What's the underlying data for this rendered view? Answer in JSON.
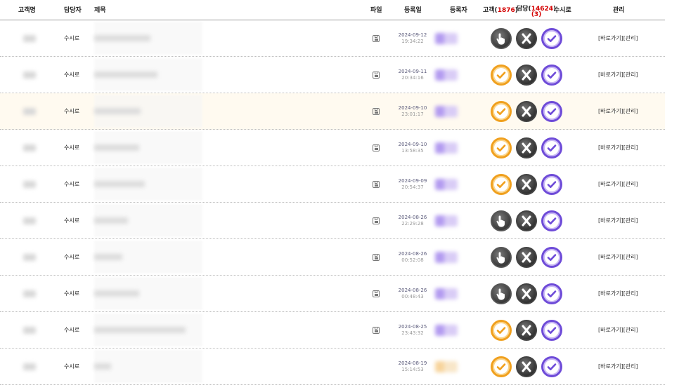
{
  "header": {
    "customer": "고객명",
    "manager": "담당자",
    "title": "제목",
    "file": "파일",
    "date": "등록일",
    "registrant": "등록자",
    "col_customer_label": "고객(",
    "col_customer_count": "1876",
    "col_manager_label": "담당(",
    "col_manager_count": "14624",
    "col_manager_sub": "(3)",
    "col_receive": "수시로",
    "manage": "관리",
    "close_paren": ")"
  },
  "colors": {
    "accent_red": "#d40000",
    "orange": "#f0a01e",
    "purple": "#6e4bd8",
    "dark": "#3a3a3a"
  },
  "rows": [
    {
      "manager": "수시로",
      "date": "2024-09-12",
      "time": "19:34:22",
      "has_file": true,
      "status": "hand",
      "title_len": 80
    },
    {
      "manager": "수시로",
      "date": "2024-09-11",
      "time": "20:34:16",
      "has_file": true,
      "status": "check",
      "title_len": 90
    },
    {
      "manager": "수시로",
      "date": "2024-09-10",
      "time": "23:01:17",
      "has_file": true,
      "status": "check",
      "title_len": 66
    },
    {
      "manager": "수시로",
      "date": "2024-09-10",
      "time": "13:58:35",
      "has_file": true,
      "status": "check",
      "title_len": 64
    },
    {
      "manager": "수시로",
      "date": "2024-09-09",
      "time": "20:54:37",
      "has_file": true,
      "status": "check",
      "title_len": 72
    },
    {
      "manager": "수시로",
      "date": "2024-08-26",
      "time": "22:29:28",
      "has_file": true,
      "status": "hand",
      "title_len": 48
    },
    {
      "manager": "수시로",
      "date": "2024-08-26",
      "time": "00:52:08",
      "has_file": true,
      "status": "hand",
      "title_len": 40
    },
    {
      "manager": "수시로",
      "date": "2024-08-26",
      "time": "00:48:43",
      "has_file": true,
      "status": "hand",
      "title_len": 64
    },
    {
      "manager": "수시로",
      "date": "2024-08-25",
      "time": "23:43:32",
      "has_file": true,
      "status": "check",
      "title_len": 130
    },
    {
      "manager": "수시로",
      "date": "2024-08-19",
      "time": "15:14:53",
      "has_file": false,
      "status": "check",
      "title_len": 24,
      "reg_color": "orange"
    }
  ],
  "highlight_row": 2,
  "manage_links": {
    "goto": "[바로가기]",
    "admin": "[관리]"
  },
  "icons": {
    "hand": "hand-pointer-icon",
    "check_orange": "check-circle-orange-icon",
    "x": "x-circle-icon",
    "check_purple": "check-circle-purple-icon",
    "file": "floppy-icon"
  }
}
